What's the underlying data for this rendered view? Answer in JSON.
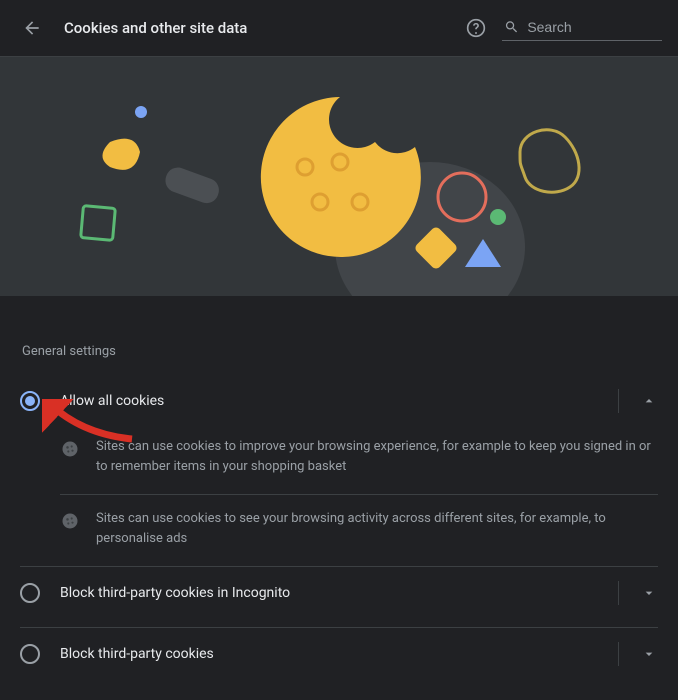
{
  "header": {
    "title": "Cookies and other site data",
    "search_placeholder": "Search"
  },
  "section_title": "General settings",
  "options": {
    "allow_all": {
      "label": "Allow all cookies",
      "detail1": "Sites can use cookies to improve your browsing experience, for example to keep you signed in or to remember items in your shopping basket",
      "detail2": "Sites can use cookies to see your browsing activity across different sites, for example, to personalise ads"
    },
    "block_incognito": {
      "label": "Block third-party cookies in Incognito"
    },
    "block_third": {
      "label": "Block third-party cookies"
    }
  }
}
